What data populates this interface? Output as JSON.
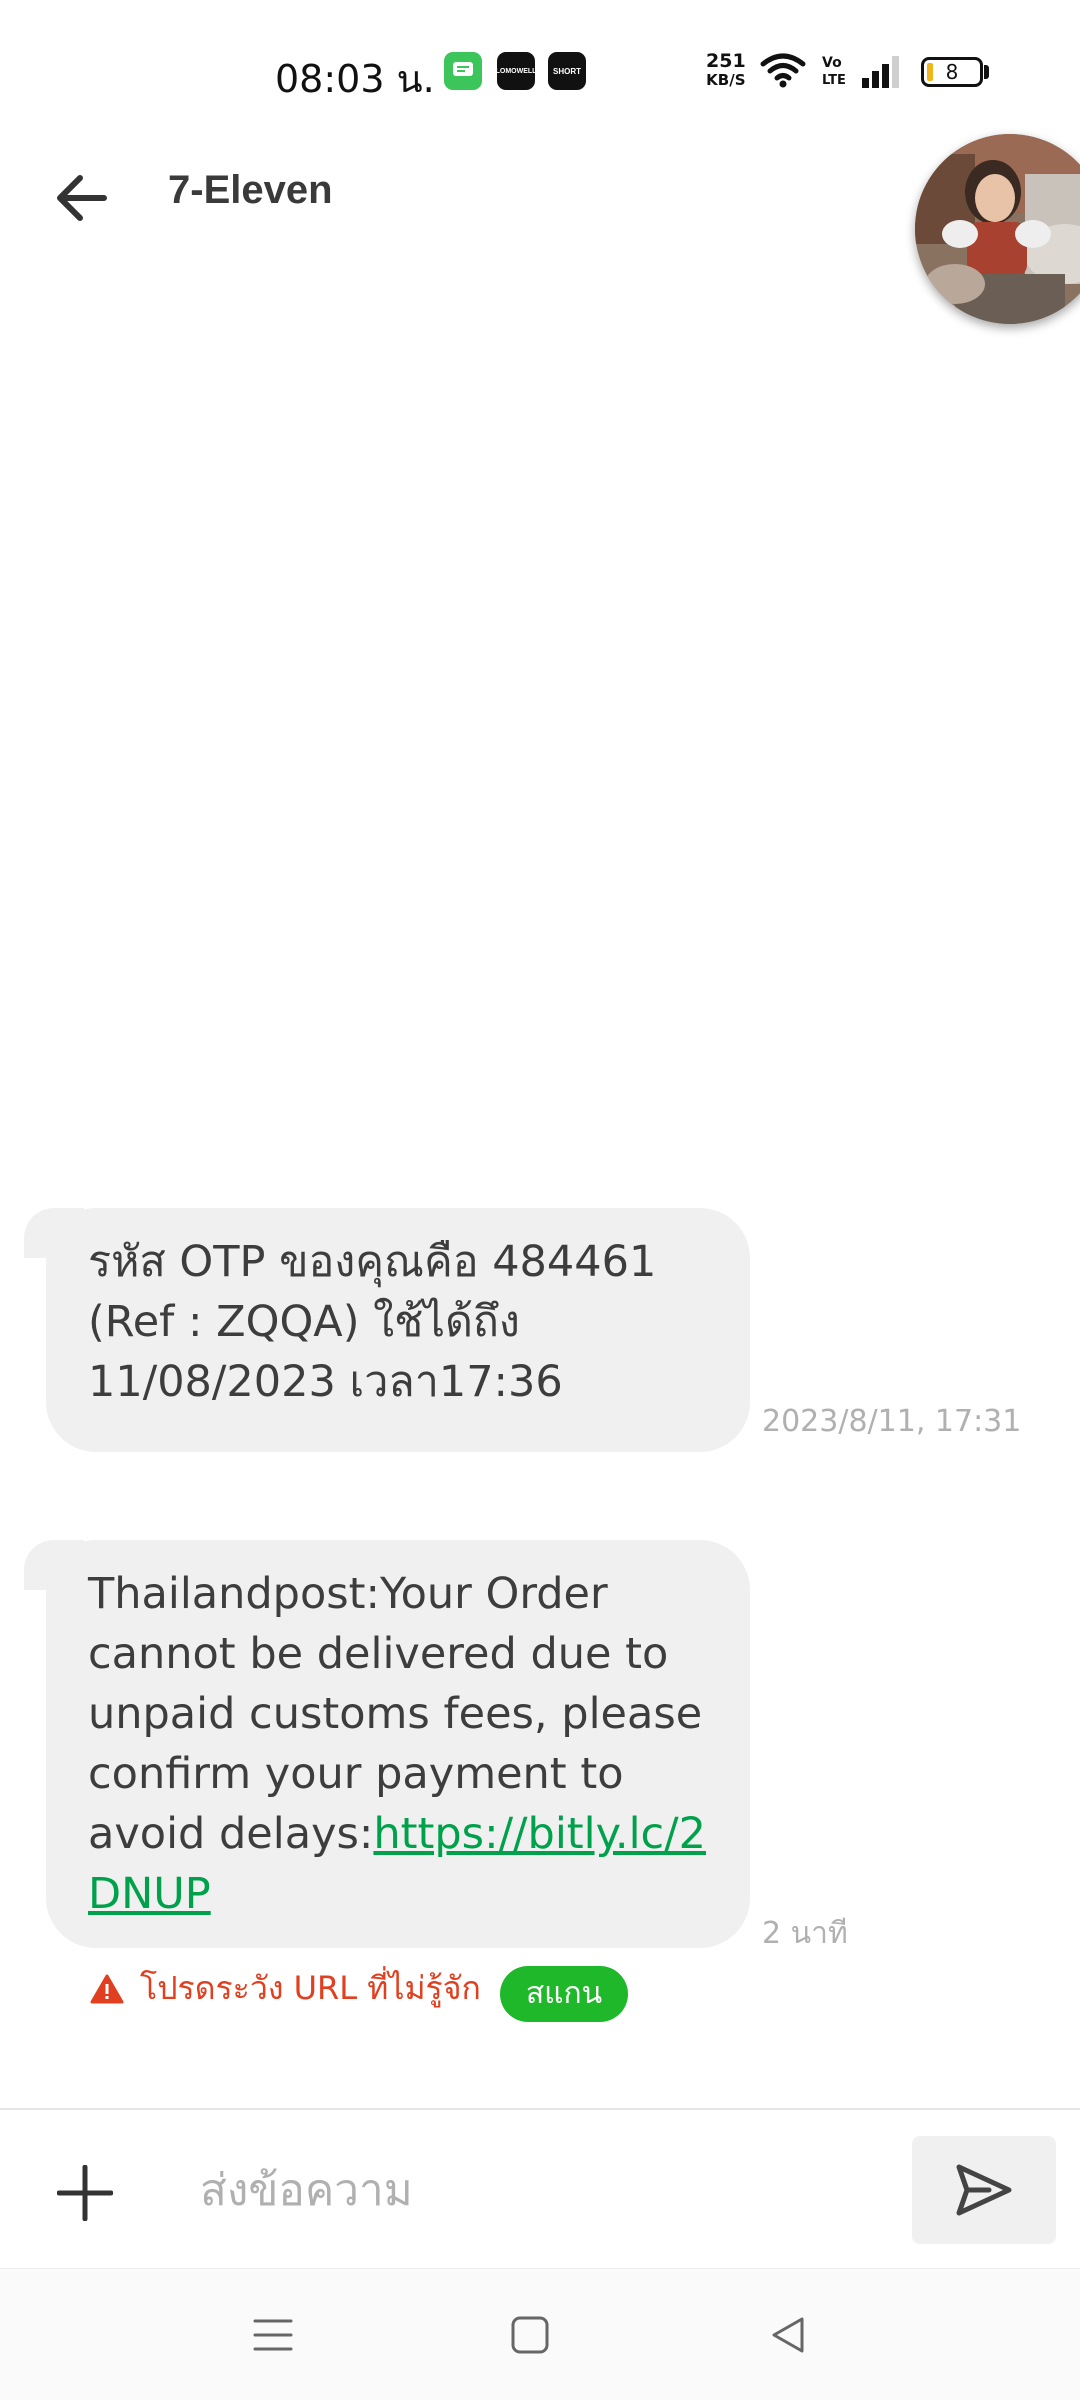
{
  "status_bar": {
    "time": "08:03 น.",
    "net_speed_value": "251",
    "net_speed_unit": "KB/S",
    "volte_label": "Vo LTE",
    "battery_level": "8",
    "apps": [
      {
        "icon": "chat-app-icon",
        "color": "#3cc55a"
      },
      {
        "icon": "lomowell-app-icon",
        "color": "#111111",
        "label": "LOMOWELL"
      },
      {
        "icon": "short-app-icon",
        "color": "#111111",
        "label": "SHORT"
      }
    ]
  },
  "header": {
    "back_icon": "arrow-left-icon",
    "title": "7-Eleven"
  },
  "messages": [
    {
      "text": "รหัส OTP ของคุณคือ  484461 (Ref : ZQQA) ใช้ได้ถึง 11/08/2023 เวลา17:36",
      "timestamp": "2023/8/11, 17:31"
    },
    {
      "text": "Thailandpost:Your Order cannot be delivered due to unpaid customs fees, please confirm your payment to avoid delays:",
      "link": "https://bitly.lc/2DNUP",
      "timestamp": "2 นาที"
    }
  ],
  "warning": {
    "icon": "warning-triangle-icon",
    "text": "โปรดระวัง URL ที่ไม่รู้จัก",
    "scan_label": "สแกน",
    "warning_color": "#e0401f",
    "scan_color": "#1fb82a"
  },
  "composer": {
    "placeholder": "ส่งข้อความ",
    "add_icon": "plus-icon",
    "send_icon": "send-icon"
  },
  "navbar": {
    "items": [
      "menu-icon",
      "home-square-icon",
      "back-triangle-icon"
    ]
  },
  "colors": {
    "link": "#00a14b",
    "bubble": "#f0f0f0"
  }
}
